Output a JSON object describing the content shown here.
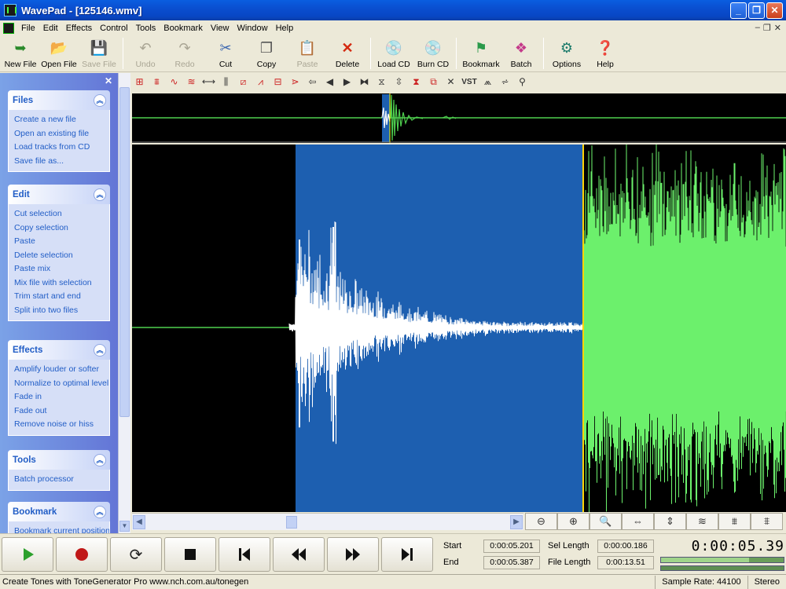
{
  "window": {
    "title": "WavePad - [125146.wmv]"
  },
  "menu": [
    "File",
    "Edit",
    "Effects",
    "Control",
    "Tools",
    "Bookmark",
    "View",
    "Window",
    "Help"
  ],
  "toolbar": {
    "new_file": "New File",
    "open_file": "Open File",
    "save_file": "Save File",
    "undo": "Undo",
    "redo": "Redo",
    "cut": "Cut",
    "copy": "Copy",
    "paste": "Paste",
    "delete": "Delete",
    "load_cd": "Load CD",
    "burn_cd": "Burn CD",
    "bookmark": "Bookmark",
    "batch": "Batch",
    "options": "Options",
    "help": "Help"
  },
  "tasks": {
    "files": {
      "title": "Files",
      "items": [
        "Create a new file",
        "Open an existing file",
        "Load tracks from CD",
        "Save file as..."
      ]
    },
    "edit": {
      "title": "Edit",
      "items": [
        "Cut selection",
        "Copy selection",
        "Paste",
        "Delete selection",
        "Paste mix",
        "Mix file with selection",
        "Trim start and end",
        "Split into two files"
      ]
    },
    "effects": {
      "title": "Effects",
      "items": [
        "Amplify louder or softer",
        "Normalize to optimal level",
        "Fade in",
        "Fade out",
        "Remove noise or hiss"
      ]
    },
    "tools": {
      "title": "Tools",
      "items": [
        "Batch processor"
      ]
    },
    "bookmark": {
      "title": "Bookmark",
      "items": [
        "Bookmark current position"
      ]
    }
  },
  "fx_vst": "VST",
  "transport": {
    "start_label": "Start",
    "end_label": "End",
    "start_value": "0:00:05.201",
    "end_value": "0:00:05.387",
    "sel_length_label": "Sel Length",
    "file_length_label": "File Length",
    "sel_length_value": "0:00:00.186",
    "file_length_value": "0:00:13.51",
    "clock": "0:00:05.39",
    "level_fraction": 0.72
  },
  "status": {
    "message": "Create Tones with ToneGenerator Pro www.nch.com.au/tonegen",
    "sample_rate": "Sample Rate: 44100",
    "channels": "Stereo"
  },
  "colors": {
    "title_blue": "#0a4fd0",
    "wave_green": "#6cf06c",
    "selection_blue": "#1d5fb0",
    "panel_blue": "#7ba2e7"
  }
}
